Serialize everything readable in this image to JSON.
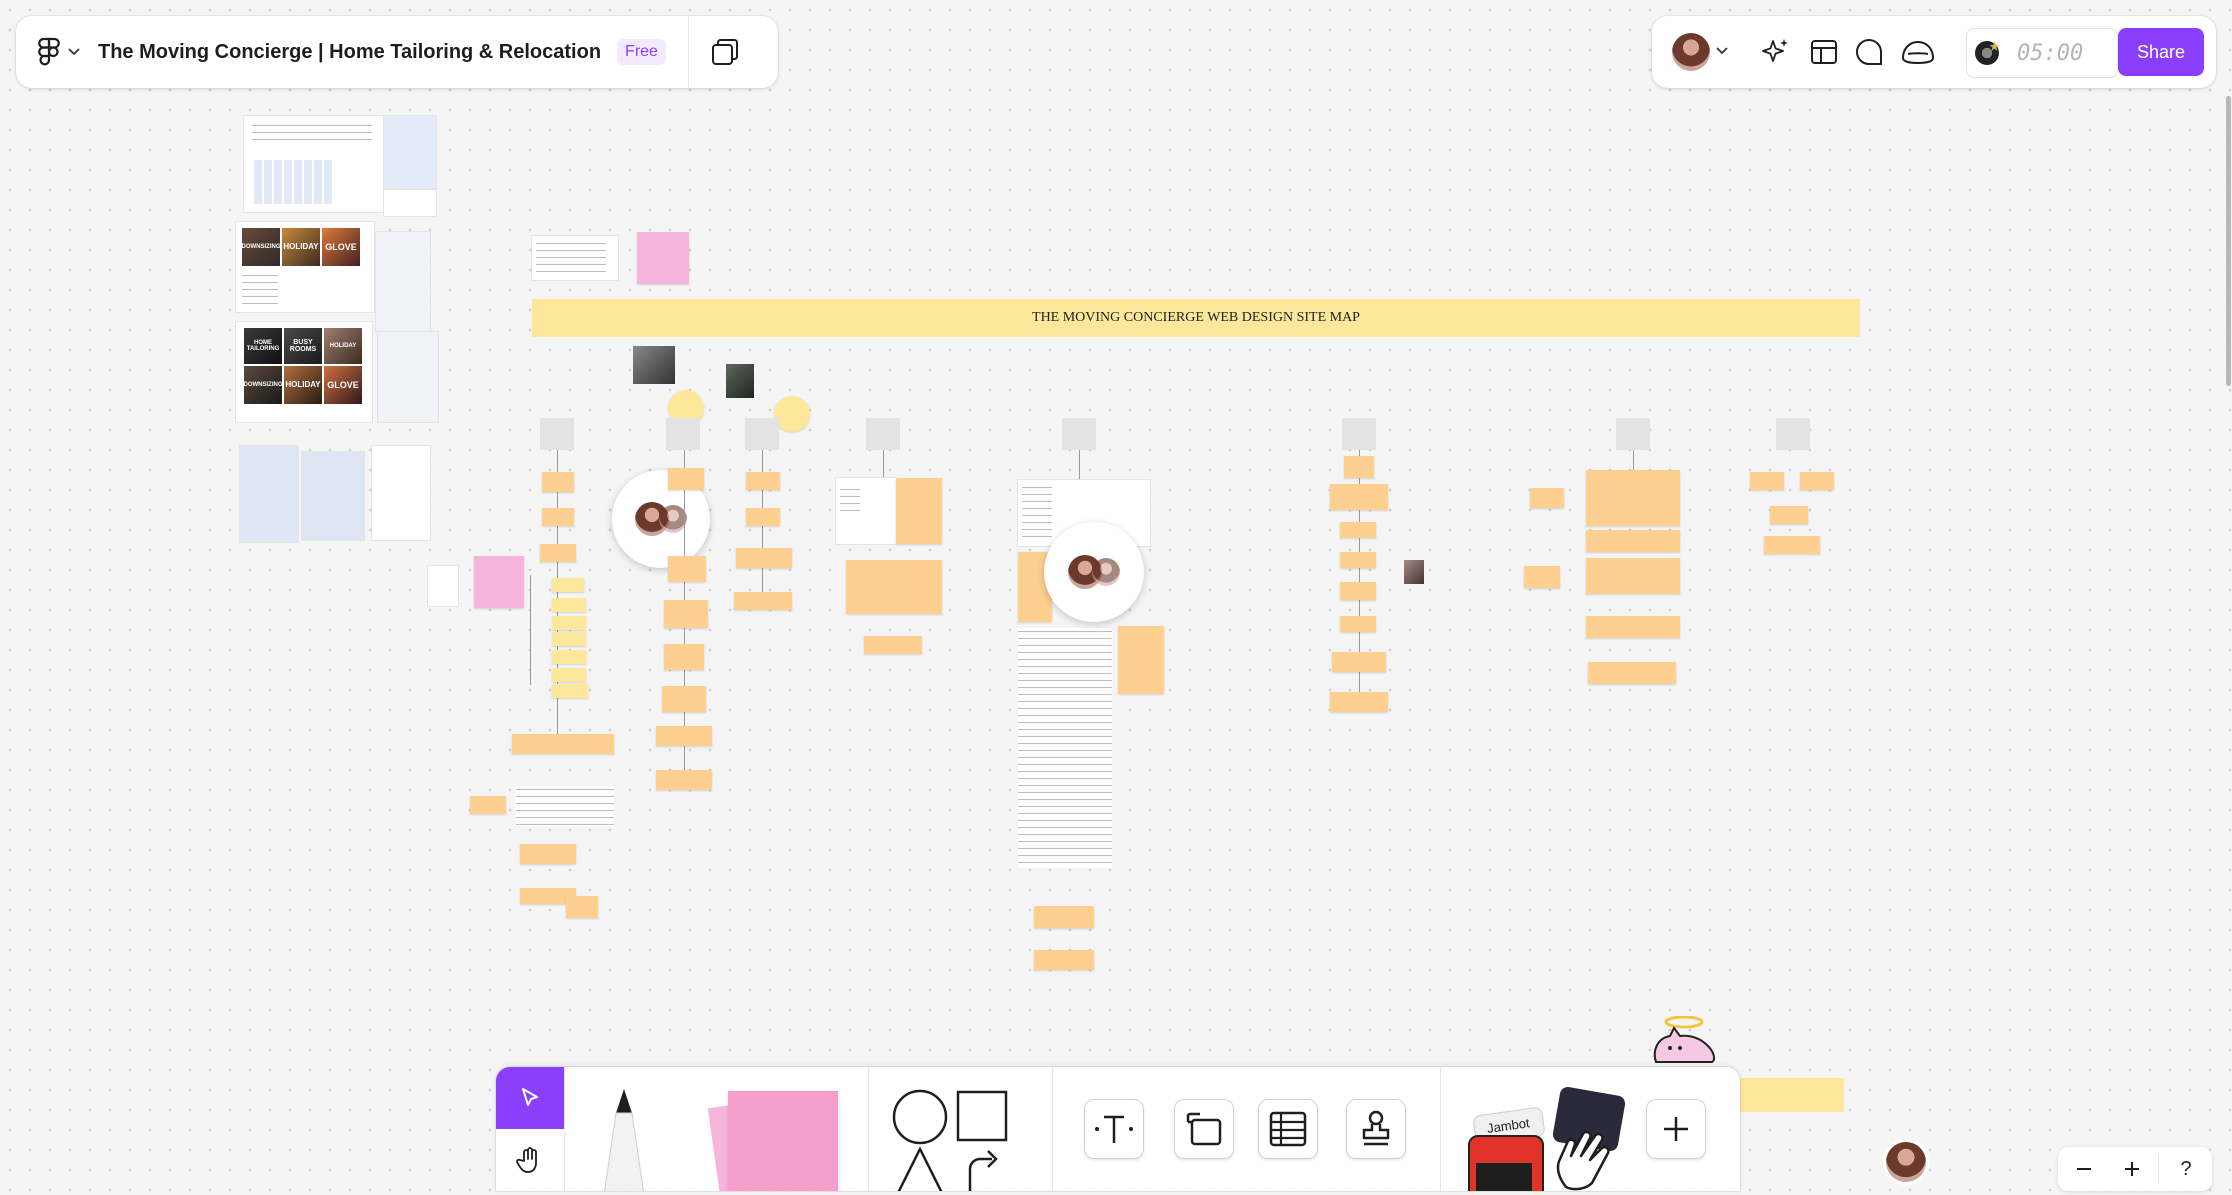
{
  "header": {
    "file_title": "The Moving Concierge | Home Tailoring & Relocation",
    "plan_badge": "Free",
    "timer": "05:00",
    "share_label": "Share"
  },
  "canvas": {
    "sitemap_title": "THE MOVING CONCIERGE WEB DESIGN SITE MAP",
    "photo_tiles": [
      "DOWNSIZING",
      "HOLIDAY",
      "GLOVE",
      "HOME TAILORING",
      "BUSY ROOMS",
      "HOLIDAY",
      "DOWNSIZING",
      "HOLIDAY",
      "GLOVE"
    ]
  },
  "toolbar": {
    "jambot_label": "Jambot",
    "tools": [
      "move-tool",
      "hand-tool",
      "marker-tool",
      "sticky-note-tool",
      "shape-tool",
      "text-tool",
      "section-tool",
      "table-tool",
      "stamp-tool",
      "widgets-tool",
      "more-tools"
    ]
  },
  "zoom": {
    "help_label": "?"
  },
  "colors": {
    "accent": "#8a3ffc",
    "sticky_orange": "#fdcf91",
    "sticky_yellow": "#fde79a",
    "sticky_pink": "#f7b4dc",
    "canvas_bg": "#f5f5f5"
  }
}
